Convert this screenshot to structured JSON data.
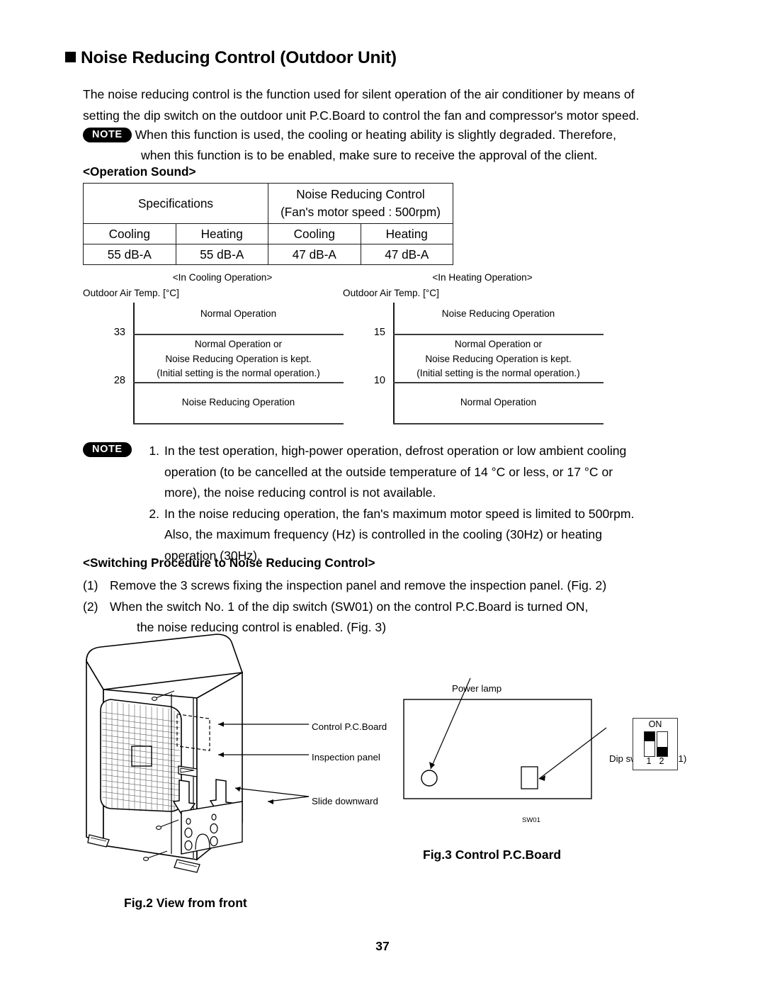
{
  "heading": "Noise Reducing Control (Outdoor Unit)",
  "intro": "The noise reducing control is the function used for silent operation of the air conditioner by means of setting the dip switch on the outdoor unit P.C.Board to control the fan and compressor's motor speed.",
  "note_label": "NOTE",
  "note_top": {
    "line1": "When this function is used, the cooling or heating ability is slightly degraded. Therefore,",
    "line2": "when this function is to be enabled, make sure to receive the approval of the client."
  },
  "operation_sound": {
    "label": "<Operation Sound>",
    "header_spec": "Specifications",
    "header_nrc_line1": "Noise Reducing Control",
    "header_nrc_line2": "(Fan's motor speed : 500rpm)",
    "columns": [
      "Cooling",
      "Heating",
      "Cooling",
      "Heating"
    ],
    "values": [
      "55 dB-A",
      "55 dB-A",
      "47 dB-A",
      "47 dB-A"
    ]
  },
  "chart_data": [
    {
      "type": "bar",
      "title": "<In Cooling Operation>",
      "ylabel": "Outdoor Air Temp. [°C]",
      "tick_labels": [
        "33",
        "28"
      ],
      "bands": [
        {
          "text": [
            "Normal Operation"
          ]
        },
        {
          "text": [
            "Normal Operation or",
            "Noise Reducing Operation is kept.",
            "(Initial setting is the normal operation.)"
          ]
        },
        {
          "text": [
            "Noise Reducing Operation"
          ]
        }
      ]
    },
    {
      "type": "bar",
      "title": "<In Heating Operation>",
      "ylabel": "Outdoor Air Temp. [°C]",
      "tick_labels": [
        "15",
        "10"
      ],
      "bands": [
        {
          "text": [
            "Noise Reducing Operation"
          ]
        },
        {
          "text": [
            "Normal Operation or",
            "Noise Reducing Operation is kept.",
            "(Initial setting is the normal operation.)"
          ]
        },
        {
          "text": [
            "Normal Operation"
          ]
        }
      ]
    }
  ],
  "note_numbered": {
    "item1_num": "1.",
    "item1_l1": "In the test operation, high-power operation, defrost operation or low ambient cooling",
    "item1_l2": "operation (to be cancelled at the outside temperature of 14 °C or less, or 17 °C or",
    "item1_l3": "more),  the noise reducing control is not available.",
    "item2_num": "2.",
    "item2_l1": "In the noise reducing operation, the fan's maximum motor speed is limited to 500rpm.",
    "item2_l2": "Also, the maximum frequency (Hz) is controlled in the cooling (30Hz) or heating",
    "item2_l3": "operation (30Hz)."
  },
  "switching": {
    "label": "<Switching Procedure to Noise Reducing Control>",
    "item1_marker": "(1)",
    "item1_text": "Remove the 3 screws fixing the inspection panel and remove the inspection panel.  (Fig. 2)",
    "item2_marker": "(2)",
    "item2_l1": "When the switch No. 1 of the dip switch (SW01) on the control P.C.Board is turned ON,",
    "item2_l2": "the noise reducing control is enabled. (Fig. 3)"
  },
  "fig2": {
    "caption": "Fig.2  View from front",
    "label_pcboard": "Control P.C.Board",
    "label_inspection": "Inspection panel",
    "label_slide": "Slide downward"
  },
  "fig3": {
    "caption": "Fig.3  Control P.C.Board",
    "label_powerlamp": "Power lamp",
    "label_dipswitch": "Dip switch (SW01)",
    "label_sw01": "SW01",
    "dip_on_label": "ON",
    "dip_numbers": [
      "1",
      "2"
    ]
  },
  "page_number": "37"
}
